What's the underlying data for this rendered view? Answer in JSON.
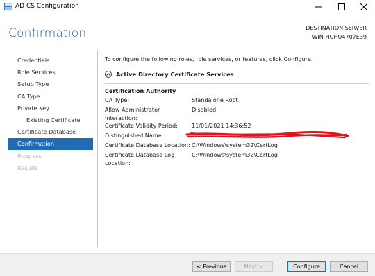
{
  "window": {
    "title": "AD CS Configuration",
    "minimize_icon": "minimize-icon",
    "maximize_icon": "maximize-icon",
    "close_icon": "close-icon"
  },
  "header": {
    "title": "Confirmation",
    "destination_label": "DESTINATION SERVER",
    "destination_server": "WIN-HUHU4707E39"
  },
  "sidebar": {
    "items": [
      {
        "label": "Credentials",
        "state": "normal"
      },
      {
        "label": "Role Services",
        "state": "normal"
      },
      {
        "label": "Setup Type",
        "state": "normal"
      },
      {
        "label": "CA Type",
        "state": "normal"
      },
      {
        "label": "Private Key",
        "state": "normal"
      },
      {
        "label": "Existing Certificate",
        "state": "sub"
      },
      {
        "label": "Certificate Database",
        "state": "normal"
      },
      {
        "label": "Confirmation",
        "state": "active"
      },
      {
        "label": "Progress",
        "state": "disabled"
      },
      {
        "label": "Results",
        "state": "disabled"
      }
    ]
  },
  "main": {
    "intro": "To configure the following roles, role services, or features, click Configure.",
    "section_title": "Active Directory Certificate Services",
    "group_title": "Certification Authority",
    "rows": [
      {
        "key": "CA Type:",
        "value": "Standalone Root"
      },
      {
        "key": "Allow Administrator Interaction:",
        "value": "Disabled"
      },
      {
        "key": "Certificate Validity Period:",
        "value": "11/01/2021 14:36:52"
      },
      {
        "key": "Distinguished Name:",
        "value": ""
      },
      {
        "key": "Certificate Database Location:",
        "value": "C:\\Windows\\system32\\CertLog"
      },
      {
        "key": "Certificate Database Log Location:",
        "value": "C:\\Windows\\system32\\CertLog"
      }
    ]
  },
  "footer": {
    "previous": "< Previous",
    "next": "Next >",
    "configure": "Configure",
    "cancel": "Cancel"
  },
  "colors": {
    "accent": "#1f6bb5",
    "header_title": "#1f5fa6",
    "redaction": "#e8111e"
  }
}
